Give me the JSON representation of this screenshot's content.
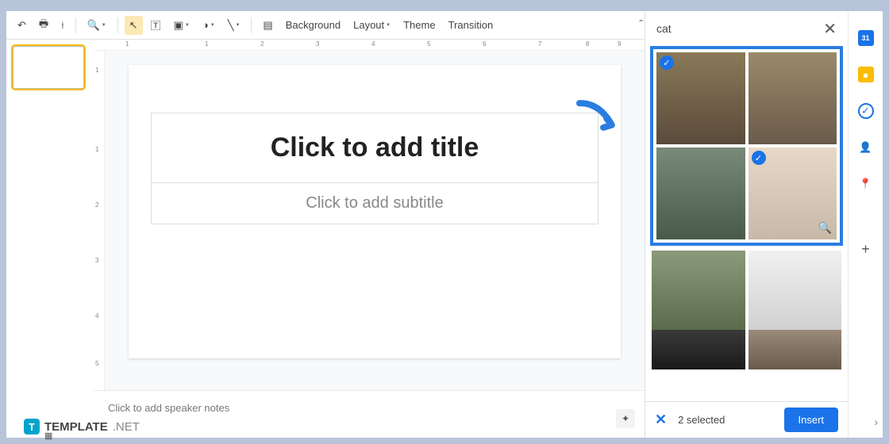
{
  "toolbar": {
    "background_label": "Background",
    "layout_label": "Layout",
    "theme_label": "Theme",
    "transition_label": "Transition"
  },
  "ruler": {
    "h_marks": [
      "1",
      "",
      "1",
      "2",
      "3",
      "4",
      "5",
      "6",
      "7",
      "8",
      "9"
    ],
    "v_marks": [
      "1",
      "",
      "1",
      "2",
      "3",
      "4",
      "5"
    ]
  },
  "slide": {
    "title_placeholder": "Click to add title",
    "subtitle_placeholder": "Click to add subtitle"
  },
  "notes": {
    "placeholder": "Click to add speaker notes"
  },
  "search": {
    "query": "cat",
    "selected_count_label": "2 selected",
    "insert_label": "Insert",
    "results": [
      {
        "selected": true
      },
      {
        "selected": false
      },
      {
        "selected": false
      },
      {
        "selected": true,
        "magnify": true
      }
    ]
  },
  "side_panel": {
    "calendar": "31"
  },
  "watermark": {
    "brand": "TEMPLATE",
    "suffix": ".NET"
  }
}
